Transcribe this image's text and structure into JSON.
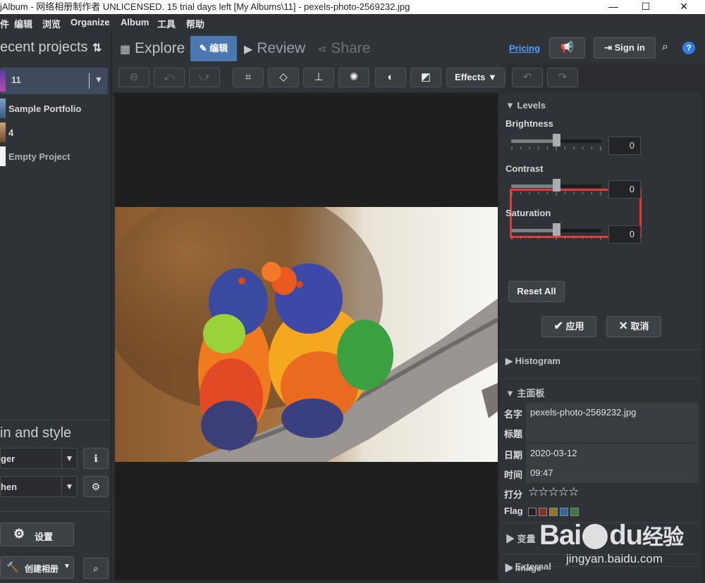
{
  "window": {
    "title": "jAlbum - 网络相册制作者 UNLICENSED. 15 trial days left [My Albums\\11] - pexels-photo-2569232.jpg"
  },
  "menu": [
    "件",
    "编辑",
    "浏览",
    "Organize",
    "Album",
    "工具",
    "帮助"
  ],
  "sidebar": {
    "header": "ecent projects",
    "projects": [
      {
        "label": "11"
      },
      {
        "label": "Sample Portfolio"
      },
      {
        "label": "4"
      },
      {
        "label": "Empty Project"
      }
    ],
    "section2": "in and style",
    "skin_value": "ger",
    "style_value": "hen",
    "settings_label": "设置",
    "create_label": "创建相册"
  },
  "tabs": {
    "explore": "Explore",
    "edit": "编辑",
    "review": "Review",
    "share": "Share"
  },
  "header": {
    "pricing": "Pricing",
    "signin": "Sign in"
  },
  "toolbar": {
    "effects": "Effects"
  },
  "levels": {
    "title": "Levels",
    "brightness_label": "Brightness",
    "brightness": 0,
    "contrast_label": "Contrast",
    "contrast": 0,
    "saturation_label": "Saturation",
    "saturation": 0,
    "slider_min": -100,
    "slider_max": 100,
    "reset": "Reset All",
    "apply": "应用",
    "cancel": "取消"
  },
  "panels": {
    "histogram": "Histogram",
    "main": "主面板",
    "variables": "变量",
    "image": "Image",
    "external": "External"
  },
  "meta": {
    "name_k": "名字",
    "name_v": "pexels-photo-2569232.jpg",
    "title_k": "标题",
    "title_v": "",
    "date_k": "日期",
    "date_v": "2020-03-12",
    "time_k": "时间",
    "time_v": "09:47",
    "rating_k": "打分",
    "rating": 0,
    "flag_k": "Flag"
  },
  "flag_colors": [
    "#222222",
    "#8b2e2e",
    "#8a7a2a",
    "#2e6a9e",
    "#3b7a3b"
  ],
  "watermark": {
    "brand": "Bai",
    "brand2": "du",
    "brand3": "经验",
    "url": "jingyan.baidu.com"
  }
}
